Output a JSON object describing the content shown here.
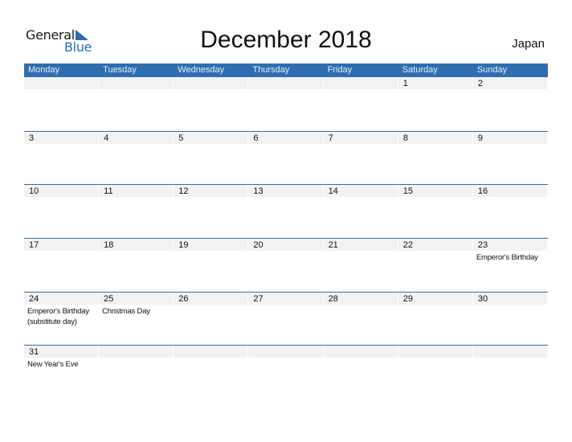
{
  "brand": {
    "line1": "General",
    "line2": "Blue",
    "accent": "#2e6eb0"
  },
  "title": "December 2018",
  "country": "Japan",
  "weekdays": [
    "Monday",
    "Tuesday",
    "Wednesday",
    "Thursday",
    "Friday",
    "Saturday",
    "Sunday"
  ],
  "weeks": [
    [
      {
        "day": ""
      },
      {
        "day": ""
      },
      {
        "day": ""
      },
      {
        "day": ""
      },
      {
        "day": ""
      },
      {
        "day": "1"
      },
      {
        "day": "2"
      }
    ],
    [
      {
        "day": "3"
      },
      {
        "day": "4"
      },
      {
        "day": "5"
      },
      {
        "day": "6"
      },
      {
        "day": "7"
      },
      {
        "day": "8"
      },
      {
        "day": "9"
      }
    ],
    [
      {
        "day": "10"
      },
      {
        "day": "11"
      },
      {
        "day": "12"
      },
      {
        "day": "13"
      },
      {
        "day": "14"
      },
      {
        "day": "15"
      },
      {
        "day": "16"
      }
    ],
    [
      {
        "day": "17"
      },
      {
        "day": "18"
      },
      {
        "day": "19"
      },
      {
        "day": "20"
      },
      {
        "day": "21"
      },
      {
        "day": "22"
      },
      {
        "day": "23",
        "event": "Emperor's Birthday"
      }
    ],
    [
      {
        "day": "24",
        "event": "Emperor's Birthday\n(substitute day)"
      },
      {
        "day": "25",
        "event": "Christmas Day"
      },
      {
        "day": "26"
      },
      {
        "day": "27"
      },
      {
        "day": "28"
      },
      {
        "day": "29"
      },
      {
        "day": "30"
      }
    ],
    [
      {
        "day": "31",
        "event": "New Year's Eve"
      },
      {
        "day": ""
      },
      {
        "day": ""
      },
      {
        "day": ""
      },
      {
        "day": ""
      },
      {
        "day": ""
      },
      {
        "day": ""
      }
    ]
  ]
}
